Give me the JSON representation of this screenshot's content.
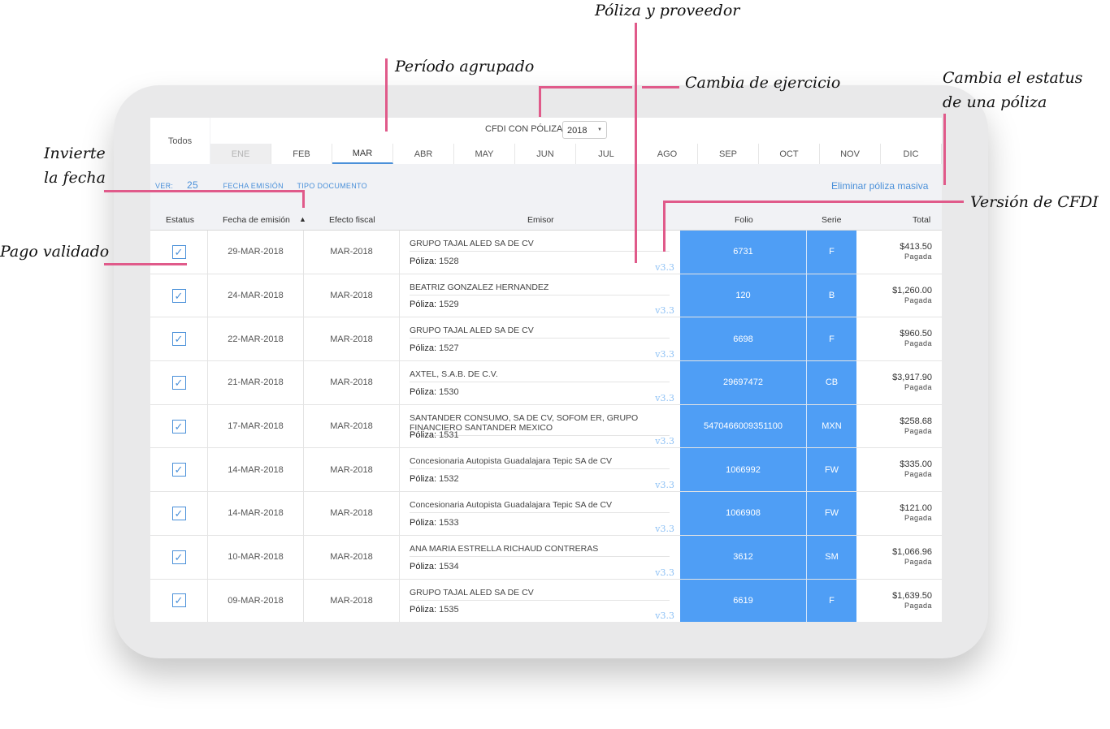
{
  "app": {
    "todos_label": "Todos",
    "cfdi_label": "CFDI CON PÓLIZA",
    "year": "2018",
    "months": [
      {
        "label": "ENE",
        "state": "disabled"
      },
      {
        "label": "FEB",
        "state": "normal"
      },
      {
        "label": "MAR",
        "state": "active"
      },
      {
        "label": "ABR",
        "state": "normal"
      },
      {
        "label": "MAY",
        "state": "normal"
      },
      {
        "label": "JUN",
        "state": "normal"
      },
      {
        "label": "JUL",
        "state": "normal"
      },
      {
        "label": "AGO",
        "state": "normal"
      },
      {
        "label": "SEP",
        "state": "normal"
      },
      {
        "label": "OCT",
        "state": "normal"
      },
      {
        "label": "NOV",
        "state": "normal"
      },
      {
        "label": "DIC",
        "state": "normal"
      }
    ],
    "filters": {
      "ver_label": "VER:",
      "ver_value": "25",
      "fecha_label": "FECHA EMISIÓN",
      "tipo_label": "TIPO DOCUMENTO"
    },
    "bulk_delete": "Eliminar póliza masiva",
    "columns": {
      "estatus": "Estatus",
      "fecha": "Fecha de emisión",
      "efecto": "Efecto fiscal",
      "emisor": "Emisor",
      "folio": "Folio",
      "serie": "Serie",
      "total": "Total"
    },
    "poliza_label": "Póliza:",
    "rows": [
      {
        "fecha": "29-MAR-2018",
        "efecto": "MAR-2018",
        "emisor": "GRUPO TAJAL ALED SA DE CV",
        "poliza": "1528",
        "version": "v3.3",
        "folio": "6731",
        "serie": "F",
        "total": "$413.50",
        "estado": "Pagada"
      },
      {
        "fecha": "24-MAR-2018",
        "efecto": "MAR-2018",
        "emisor": "BEATRIZ GONZALEZ HERNANDEZ",
        "poliza": "1529",
        "version": "v3.3",
        "folio": "120",
        "serie": "B",
        "total": "$1,260.00",
        "estado": "Pagada"
      },
      {
        "fecha": "22-MAR-2018",
        "efecto": "MAR-2018",
        "emisor": "GRUPO TAJAL ALED SA DE CV",
        "poliza": "1527",
        "version": "v3.3",
        "folio": "6698",
        "serie": "F",
        "total": "$960.50",
        "estado": "Pagada"
      },
      {
        "fecha": "21-MAR-2018",
        "efecto": "MAR-2018",
        "emisor": "AXTEL, S.A.B. DE C.V.",
        "poliza": "1530",
        "version": "v3.3",
        "folio": "29697472",
        "serie": "CB",
        "total": "$3,917.90",
        "estado": "Pagada"
      },
      {
        "fecha": "17-MAR-2018",
        "efecto": "MAR-2018",
        "emisor": "SANTANDER CONSUMO, SA DE CV, SOFOM ER, GRUPO FINANCIERO SANTANDER MEXICO",
        "poliza": "1531",
        "version": "v3.3",
        "folio": "5470466009351100",
        "serie": "MXN",
        "total": "$258.68",
        "estado": "Pagada"
      },
      {
        "fecha": "14-MAR-2018",
        "efecto": "MAR-2018",
        "emisor": "Concesionaria Autopista Guadalajara Tepic SA de CV",
        "poliza": "1532",
        "version": "v3.3",
        "folio": "1066992",
        "serie": "FW",
        "total": "$335.00",
        "estado": "Pagada"
      },
      {
        "fecha": "14-MAR-2018",
        "efecto": "MAR-2018",
        "emisor": "Concesionaria Autopista Guadalajara Tepic SA de CV",
        "poliza": "1533",
        "version": "v3.3",
        "folio": "1066908",
        "serie": "FW",
        "total": "$121.00",
        "estado": "Pagada"
      },
      {
        "fecha": "10-MAR-2018",
        "efecto": "MAR-2018",
        "emisor": "ANA MARIA ESTRELLA RICHAUD CONTRERAS",
        "poliza": "1534",
        "version": "v3.3",
        "folio": "3612",
        "serie": "SM",
        "total": "$1,066.96",
        "estado": "Pagada"
      },
      {
        "fecha": "09-MAR-2018",
        "efecto": "MAR-2018",
        "emisor": "GRUPO TAJAL ALED SA DE CV",
        "poliza": "1535",
        "version": "v3.3",
        "folio": "6619",
        "serie": "F",
        "total": "$1,639.50",
        "estado": "Pagada"
      }
    ]
  },
  "annotations": {
    "poliza_proveedor": "Póliza y proveedor",
    "periodo": "Período agrupado",
    "ejercicio": "Cambia de ejercicio",
    "estatus_1": "Cambia el estatus",
    "estatus_2": "de una póliza",
    "invierte_1": "Invierte",
    "invierte_2": "la fecha",
    "version": "Versión de CFDI",
    "pago": "Pago validado"
  },
  "colors": {
    "accent": "#4a90d9",
    "folio_bg": "#4f9ef5",
    "annotation_line": "#e05a8a",
    "version_text": "#8fc2f5"
  },
  "icons": {
    "check": "checkbox-checked-icon",
    "sort": "arrow-up-icon",
    "select": "caret-down-icon"
  }
}
